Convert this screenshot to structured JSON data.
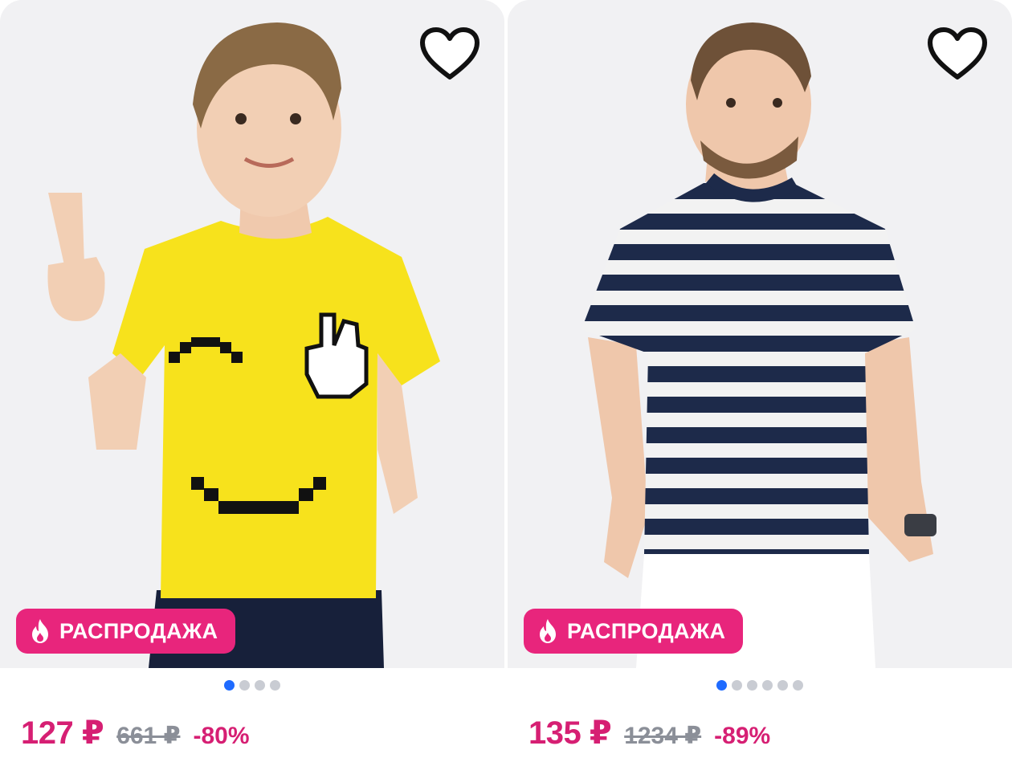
{
  "products": [
    {
      "badge_label": "РАСПРОДАЖА",
      "price_current": "127 ₽",
      "price_old": "661 ₽",
      "discount": "-80%",
      "photo_count": 4,
      "active_photo": 1,
      "favorite_icon": "heart-outline-icon",
      "badge_icon": "flame-icon",
      "colors": {
        "accent": "#e8257c",
        "dot_active": "#1f6bff",
        "shirt": "#f7e21c"
      }
    },
    {
      "badge_label": "РАСПРОДАЖА",
      "price_current": "135 ₽",
      "price_old": "1234 ₽",
      "discount": "-89%",
      "photo_count": 6,
      "active_photo": 1,
      "favorite_icon": "heart-outline-icon",
      "badge_icon": "flame-icon",
      "colors": {
        "accent": "#e8257c",
        "dot_active": "#1f6bff",
        "stripe_dark": "#1d2a4a",
        "stripe_light": "#f2f2f2"
      }
    }
  ]
}
